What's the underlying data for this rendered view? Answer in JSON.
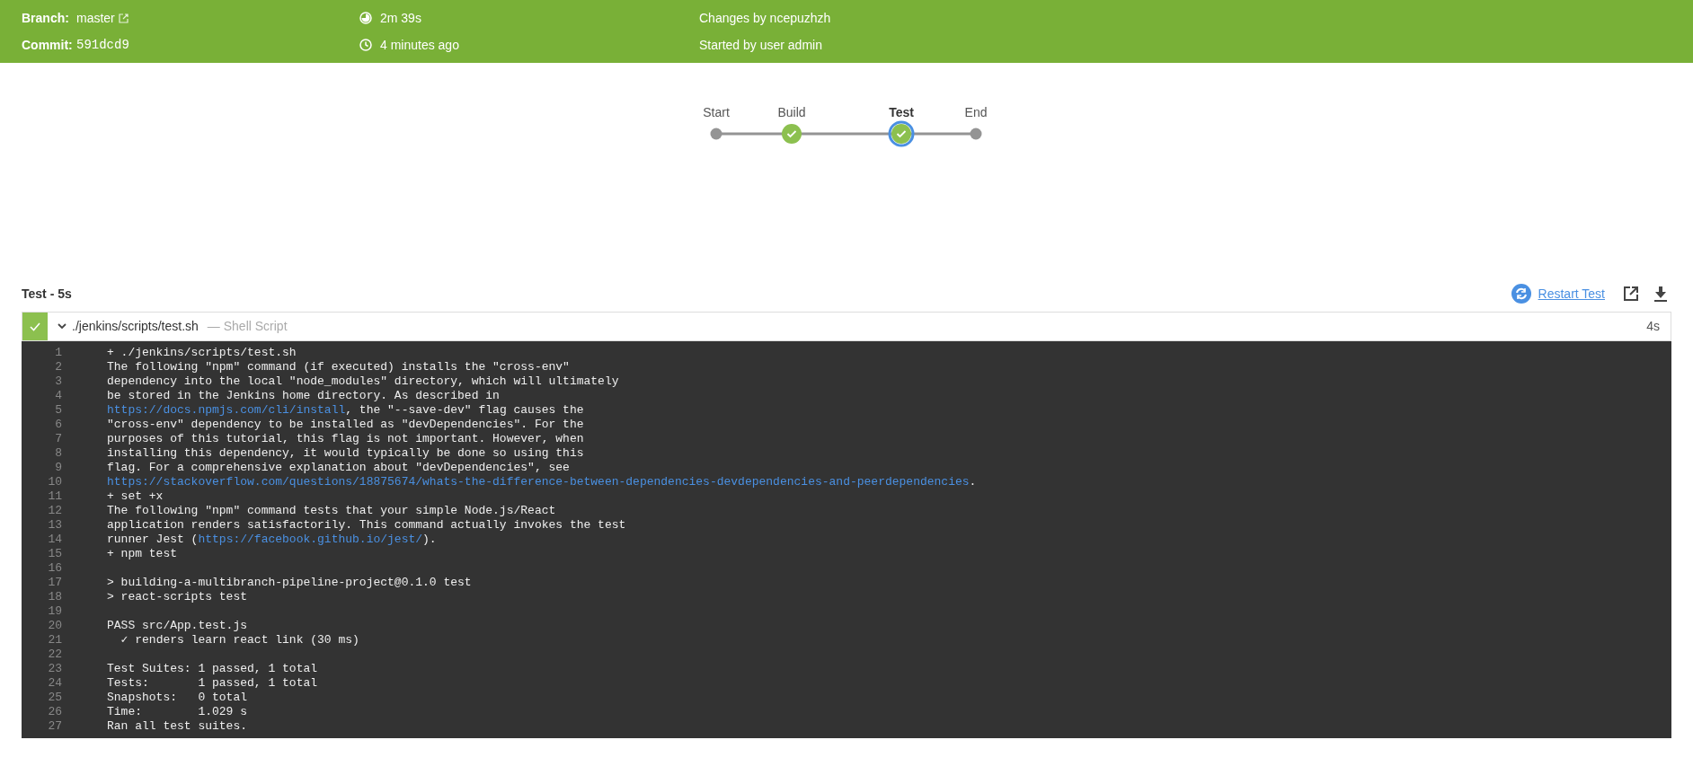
{
  "header": {
    "rows": [
      {
        "label": "Branch:",
        "value": {
          "kind": "link",
          "text": "master"
        },
        "middle": {
          "kind": "duration",
          "text": "2m 39s"
        },
        "right": "Changes by ncepuzhzh"
      },
      {
        "label": "Commit:",
        "value": {
          "kind": "code",
          "text": "591dcd9"
        },
        "middle": {
          "kind": "clock",
          "text": "4 minutes ago"
        },
        "right": "Started by user admin"
      }
    ]
  },
  "pipeline": {
    "stages": [
      {
        "label": "Start",
        "kind": "terminal",
        "selected": false
      },
      {
        "label": "Build",
        "kind": "stage",
        "selected": false
      },
      {
        "label": "Test",
        "kind": "stage",
        "selected": true
      },
      {
        "label": "End",
        "kind": "terminal",
        "selected": false
      }
    ]
  },
  "step_panel": {
    "title": "Test - 5s",
    "restart_label": "Restart Test",
    "step": {
      "passed": true,
      "expanded": true,
      "name": "./jenkins/scripts/test.sh",
      "type": "— Shell Script",
      "duration": "4s"
    },
    "log": [
      {
        "number": "1",
        "segments": [
          {
            "text": "+ ./jenkins/scripts/test.sh",
            "link": false
          }
        ]
      },
      {
        "number": "2",
        "segments": [
          {
            "text": "The following \"npm\" command (if executed) installs the \"cross-env\"",
            "link": false
          }
        ]
      },
      {
        "number": "3",
        "segments": [
          {
            "text": "dependency into the local \"node_modules\" directory, which will ultimately",
            "link": false
          }
        ]
      },
      {
        "number": "4",
        "segments": [
          {
            "text": "be stored in the Jenkins home directory. As described in",
            "link": false
          }
        ]
      },
      {
        "number": "5",
        "segments": [
          {
            "text": "https://docs.npmjs.com/cli/install",
            "link": true
          },
          {
            "text": ", the \"--save-dev\" flag causes the",
            "link": false
          }
        ]
      },
      {
        "number": "6",
        "segments": [
          {
            "text": "\"cross-env\" dependency to be installed as \"devDependencies\". For the",
            "link": false
          }
        ]
      },
      {
        "number": "7",
        "segments": [
          {
            "text": "purposes of this tutorial, this flag is not important. However, when",
            "link": false
          }
        ]
      },
      {
        "number": "8",
        "segments": [
          {
            "text": "installing this dependency, it would typically be done so using this",
            "link": false
          }
        ]
      },
      {
        "number": "9",
        "segments": [
          {
            "text": "flag. For a comprehensive explanation about \"devDependencies\", see",
            "link": false
          }
        ]
      },
      {
        "number": "10",
        "segments": [
          {
            "text": "https://stackoverflow.com/questions/18875674/whats-the-difference-between-dependencies-devdependencies-and-peerdependencies",
            "link": true
          },
          {
            "text": ".",
            "link": false
          }
        ]
      },
      {
        "number": "11",
        "segments": [
          {
            "text": "+ set +x",
            "link": false
          }
        ]
      },
      {
        "number": "12",
        "segments": [
          {
            "text": "The following \"npm\" command tests that your simple Node.js/React",
            "link": false
          }
        ]
      },
      {
        "number": "13",
        "segments": [
          {
            "text": "application renders satisfactorily. This command actually invokes the test",
            "link": false
          }
        ]
      },
      {
        "number": "14",
        "segments": [
          {
            "text": "runner Jest (",
            "link": false
          },
          {
            "text": "https://facebook.github.io/jest/",
            "link": true
          },
          {
            "text": ").",
            "link": false
          }
        ]
      },
      {
        "number": "15",
        "segments": [
          {
            "text": "+ npm test",
            "link": false
          }
        ]
      },
      {
        "number": "16"
      },
      {
        "number": "17",
        "segments": [
          {
            "text": "> building-a-multibranch-pipeline-project@0.1.0 test",
            "link": false
          }
        ]
      },
      {
        "number": "18",
        "segments": [
          {
            "text": "> react-scripts test",
            "link": false
          }
        ]
      },
      {
        "number": "19"
      },
      {
        "number": "20",
        "segments": [
          {
            "text": "PASS src/App.test.js",
            "link": false
          }
        ]
      },
      {
        "number": "21",
        "segments": [
          {
            "text": "  ✓ renders learn react link (30 ms)",
            "link": false
          }
        ]
      },
      {
        "number": "22"
      },
      {
        "number": "23",
        "segments": [
          {
            "text": "Test Suites: 1 passed, 1 total",
            "link": false
          }
        ]
      },
      {
        "number": "24",
        "segments": [
          {
            "text": "Tests:       1 passed, 1 total",
            "link": false
          }
        ]
      },
      {
        "number": "25",
        "segments": [
          {
            "text": "Snapshots:   0 total",
            "link": false
          }
        ]
      },
      {
        "number": "26",
        "segments": [
          {
            "text": "Time:        1.029 s",
            "link": false
          }
        ]
      },
      {
        "number": "27",
        "segments": [
          {
            "text": "Ran all test suites.",
            "link": false
          }
        ]
      }
    ]
  }
}
